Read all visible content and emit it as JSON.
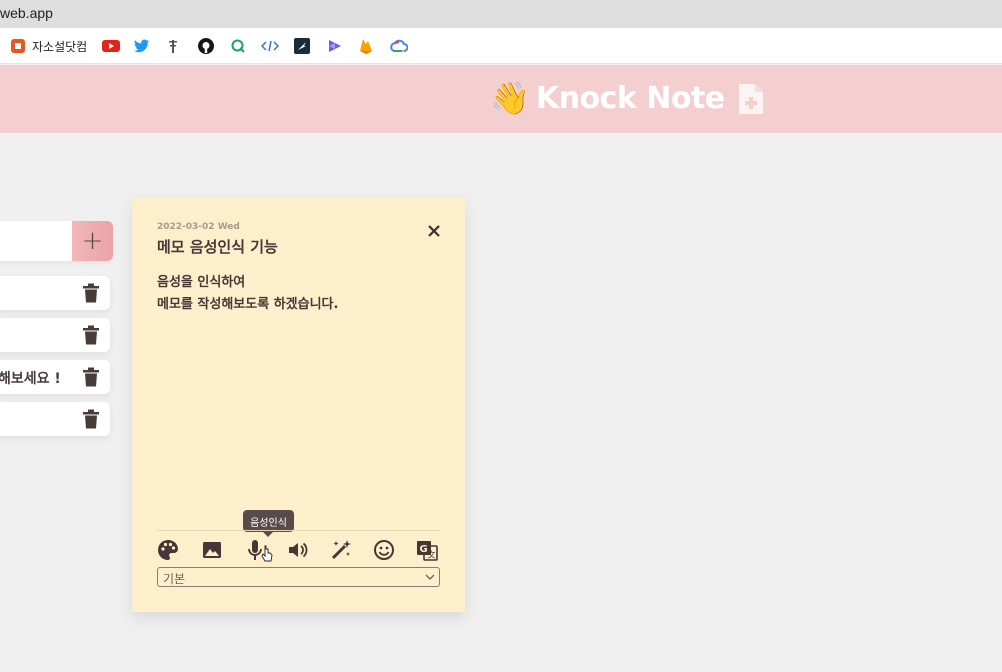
{
  "browser": {
    "url": "web.app",
    "bookmarks": [
      {
        "label": "자소설닷컴",
        "icon": "office-icon"
      },
      {
        "label": "",
        "icon": "youtube-icon"
      },
      {
        "label": "",
        "icon": "twitter-icon"
      },
      {
        "label": "",
        "icon": "tree-icon"
      },
      {
        "label": "",
        "icon": "github-icon"
      },
      {
        "label": "",
        "icon": "search-q-icon"
      },
      {
        "label": "",
        "icon": "code-icon"
      },
      {
        "label": "",
        "icon": "zap-icon"
      },
      {
        "label": "",
        "icon": "shape-icon"
      },
      {
        "label": "",
        "icon": "firebase-icon"
      },
      {
        "label": "",
        "icon": "cloud-icon"
      }
    ]
  },
  "header": {
    "emoji": "👋",
    "title": "Knock Note"
  },
  "sidebar": {
    "add_label": "+",
    "items": [
      {
        "text": ""
      },
      {
        "text": ""
      },
      {
        "text": "해보세요 !"
      },
      {
        "text": ""
      }
    ]
  },
  "note": {
    "date": "2022-03-02 Wed",
    "title": "메모 음성인식 기능",
    "body": "음성을 인식하여\n메모를 작성해보도록 하겠습니다.",
    "tooltip": "음성인식",
    "tools": [
      "palette-icon",
      "image-icon",
      "mic-icon",
      "volume-icon",
      "magic-wand-icon",
      "smile-icon",
      "translate-icon"
    ],
    "font_select": "기본"
  },
  "colors": {
    "header_bg": "#f4cfd0",
    "note_bg": "#fdefcc",
    "page_bg": "#f1f0f0",
    "text": "#4a3535"
  }
}
